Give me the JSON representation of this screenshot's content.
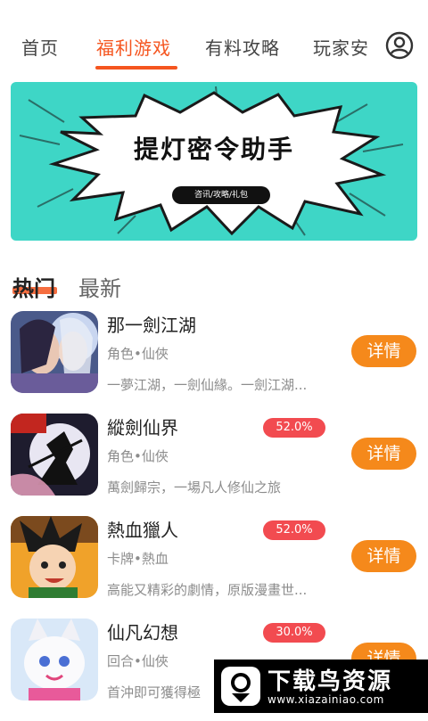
{
  "nav": {
    "tabs": [
      "首页",
      "福利游戏",
      "有料攻略",
      "玩家安"
    ],
    "active_index": 1,
    "accent_color": "#f5551f"
  },
  "banner": {
    "title": "提灯密令助手",
    "pill": "咨讯/攻略/礼包",
    "bg_color": "#3ed6c6"
  },
  "sections": {
    "hot": "热门",
    "new": "最新"
  },
  "games": [
    {
      "name": "那一劍江湖",
      "tags": "角色•仙俠",
      "desc": "一夢江湖，一劍仙緣。一劍江湖...",
      "discount": "",
      "button": "详情",
      "icon": "game-jianghu-icon"
    },
    {
      "name": "縱劍仙界",
      "tags": "角色•仙俠",
      "desc": "萬劍歸宗，一場凡人修仙之旅",
      "discount": "52.0%",
      "button": "详情",
      "icon": "game-zongjian-icon"
    },
    {
      "name": "熱血獵人",
      "tags": "卡牌•熱血",
      "desc": "高能又精彩的劇情，原版漫畫世...",
      "discount": "52.0%",
      "button": "详情",
      "icon": "game-hunter-icon"
    },
    {
      "name": "仙凡幻想",
      "tags": "回合•仙俠",
      "desc": "首沖即可獲得極",
      "discount": "30.0%",
      "button": "详情",
      "icon": "game-xianfan-icon"
    }
  ],
  "watermark": {
    "title": "下载鸟资源",
    "url": "www.xiazainiao.com"
  },
  "colors": {
    "button": "#f5891b",
    "discount": "#f24b50",
    "text_muted": "#8c8c8c"
  }
}
